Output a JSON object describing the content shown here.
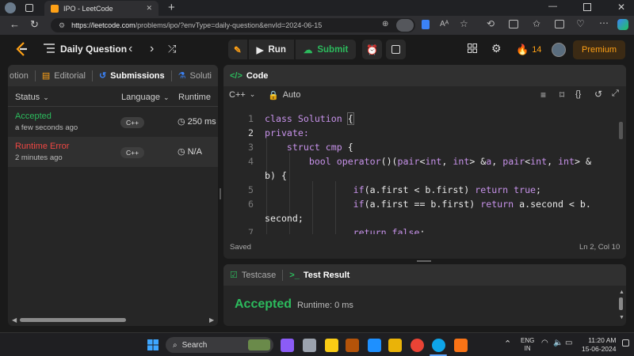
{
  "browser": {
    "tab_title": "IPO - LeetCode",
    "url_host": "https://leetcode.com",
    "url_path": "/problems/ipo/?envType=daily-question&envId=2024-06-15"
  },
  "nav": {
    "daily_question": "Daily Question",
    "run_label": "Run",
    "submit_label": "Submit",
    "streak_count": "14",
    "premium_label": "Premium"
  },
  "left_panel": {
    "tabs": [
      {
        "label": "otion"
      },
      {
        "label": "Editorial"
      },
      {
        "label": "Submissions"
      },
      {
        "label": "Soluti"
      }
    ],
    "columns": {
      "status": "Status",
      "language": "Language",
      "runtime": "Runtime"
    },
    "submissions": [
      {
        "status": "Accepted",
        "time_ago": "a few seconds ago",
        "language": "C++",
        "runtime": "250 ms"
      },
      {
        "status": "Runtime Error",
        "time_ago": "2 minutes ago",
        "language": "C++",
        "runtime": "N/A"
      }
    ]
  },
  "code_panel": {
    "title": "Code",
    "language": "C++",
    "auto_label": "Auto",
    "saved_label": "Saved",
    "cursor_pos": "Ln 2, Col 10",
    "line_numbers": [
      "1",
      "2",
      "3",
      "4",
      "",
      "5",
      "6",
      "",
      "7"
    ]
  },
  "test_panel": {
    "testcase_tab": "Testcase",
    "result_tab": "Test Result",
    "result_status": "Accepted",
    "runtime_text": "Runtime: 0 ms"
  },
  "taskbar": {
    "search_placeholder": "Search",
    "lang_line1": "ENG",
    "lang_line2": "IN",
    "time": "11:20 AM",
    "date": "15-06-2024"
  },
  "colors": {
    "accepted": "#2cbb5d",
    "error": "#ef4743",
    "brand_orange": "#ffa116",
    "keyword": "#c792ea",
    "type": "#82aaff"
  },
  "icons": [
    "leetcode-logo-icon",
    "list-icon",
    "chevron-left-icon",
    "chevron-right-icon",
    "shuffle-icon",
    "debug-icon",
    "play-icon",
    "cloud-upload-icon",
    "alarm-icon",
    "note-icon",
    "layout-icon",
    "gear-icon",
    "flame-icon",
    "avatar"
  ]
}
